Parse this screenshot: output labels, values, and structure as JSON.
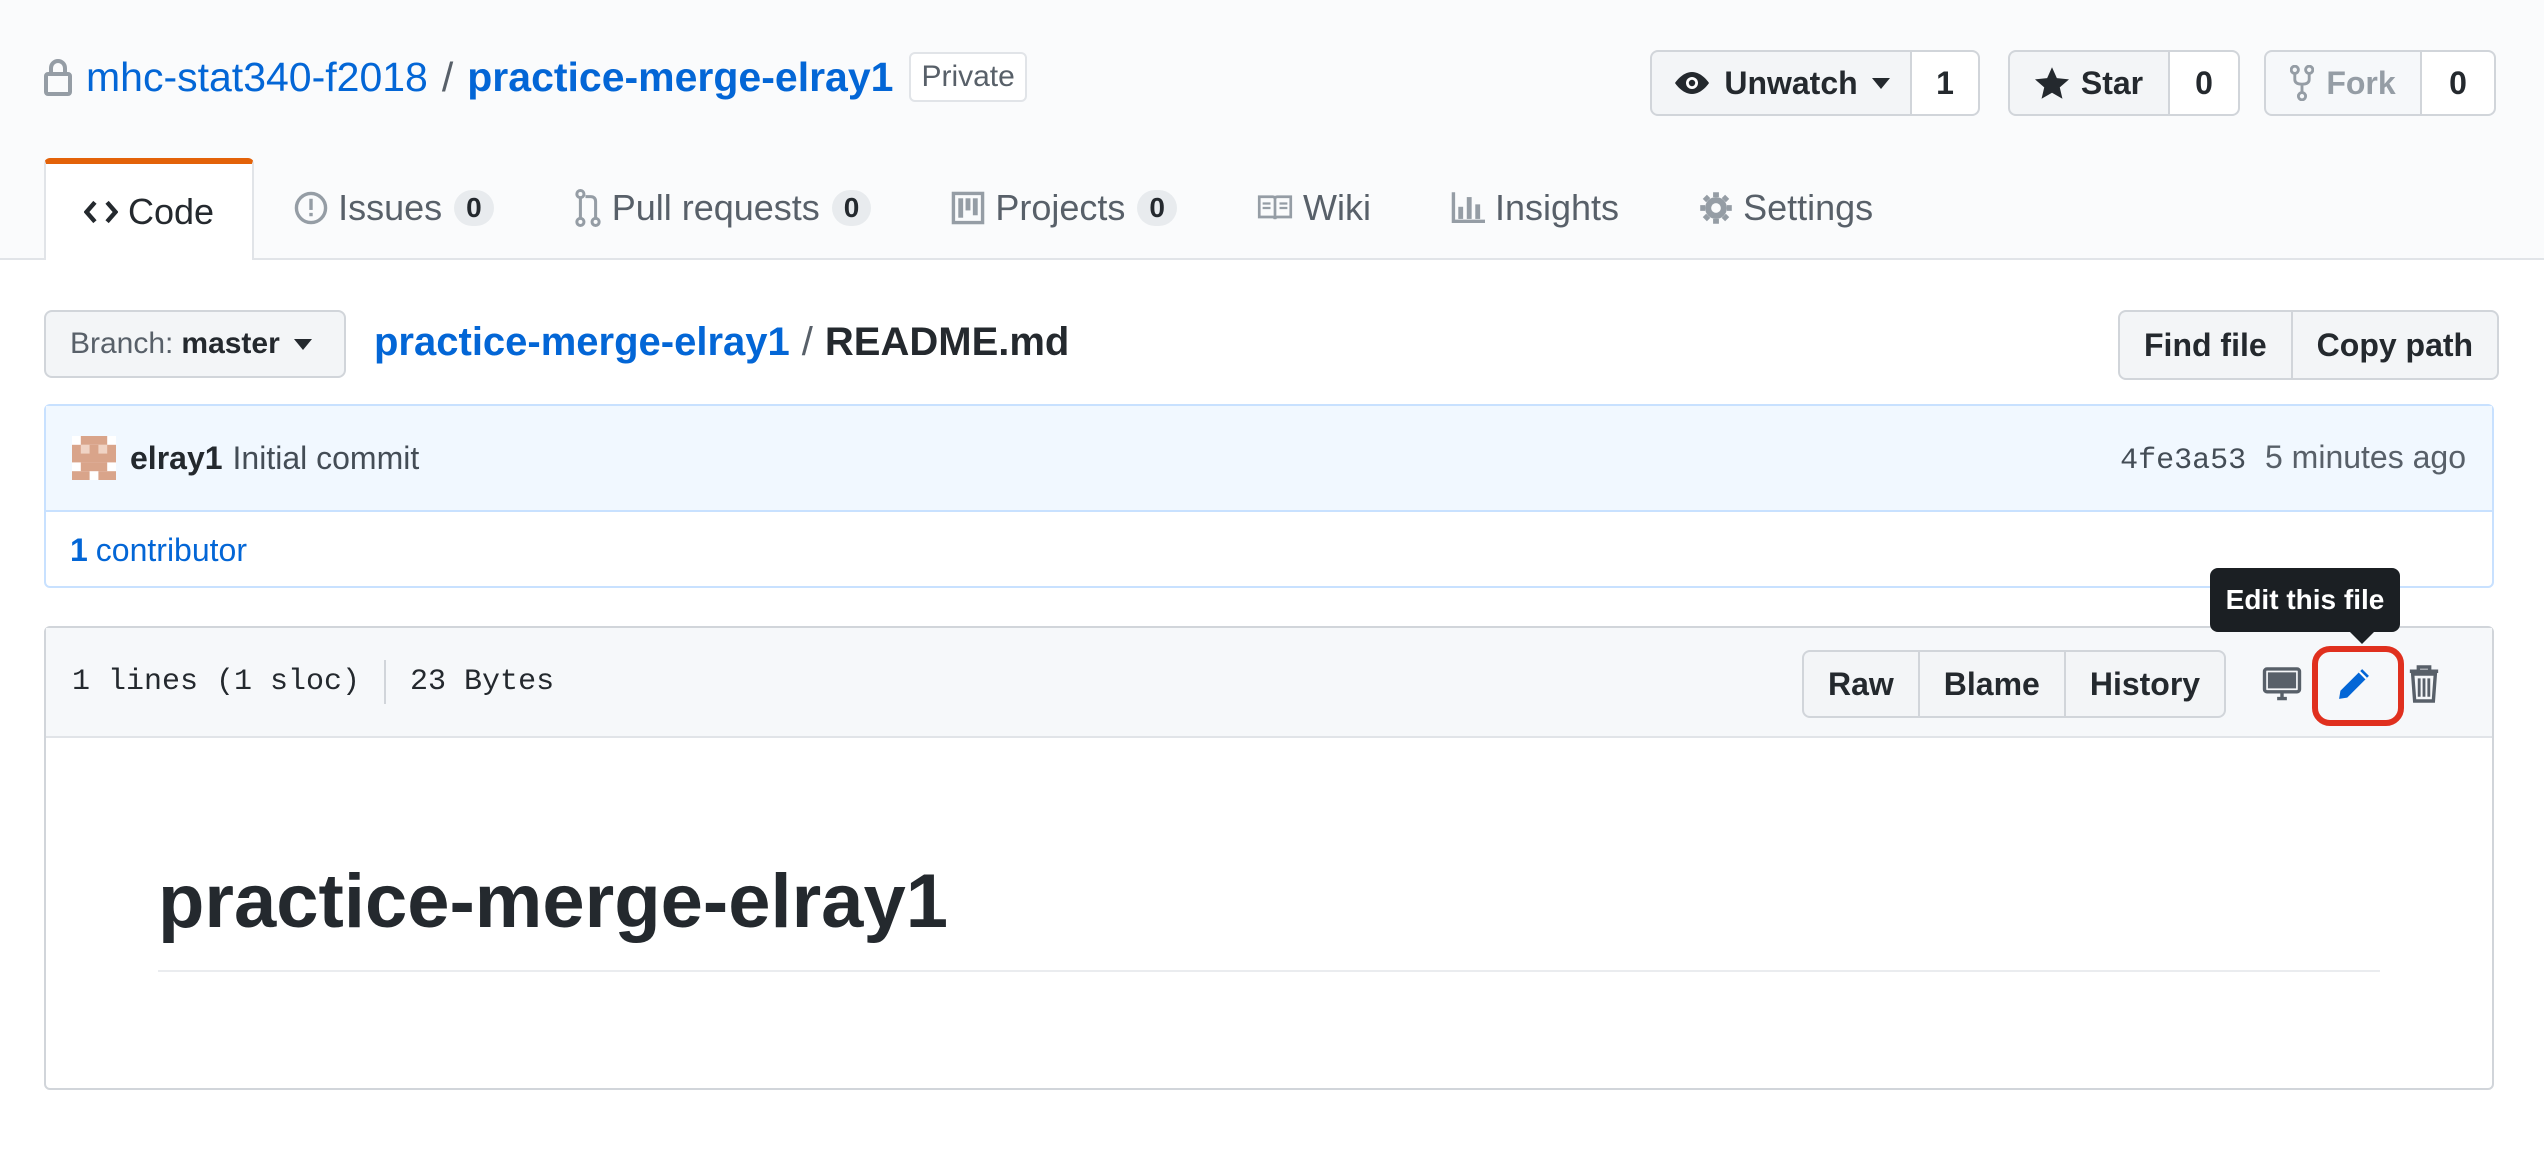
{
  "repo": {
    "owner": "mhc-stat340-f2018",
    "separator": "/",
    "name": "practice-merge-elray1",
    "visibility": "Private"
  },
  "actions": {
    "watch": {
      "label": "Unwatch",
      "count": "1"
    },
    "star": {
      "label": "Star",
      "count": "0"
    },
    "fork": {
      "label": "Fork",
      "count": "0"
    }
  },
  "tabs": [
    {
      "label": "Code",
      "icon": "code-icon"
    },
    {
      "label": "Issues",
      "count": "0",
      "icon": "issue-icon"
    },
    {
      "label": "Pull requests",
      "count": "0",
      "icon": "pull-request-icon"
    },
    {
      "label": "Projects",
      "count": "0",
      "icon": "project-icon"
    },
    {
      "label": "Wiki",
      "icon": "book-icon"
    },
    {
      "label": "Insights",
      "icon": "graph-icon"
    },
    {
      "label": "Settings",
      "icon": "gear-icon"
    }
  ],
  "branch": {
    "prefix": "Branch:",
    "name": "master"
  },
  "breadcrumb": {
    "repo": "practice-merge-elray1",
    "separator": "/",
    "file": "README.md"
  },
  "file_actions": {
    "find": "Find file",
    "copy": "Copy path"
  },
  "commit": {
    "author": "elray1",
    "message": "Initial commit",
    "sha": "4fe3a53",
    "time": "5 minutes ago"
  },
  "contributors": {
    "count": "1",
    "label": "contributor"
  },
  "file_info": {
    "lines": "1 lines (1 sloc)",
    "size": "23 Bytes"
  },
  "file_buttons": {
    "raw": "Raw",
    "blame": "Blame",
    "history": "History"
  },
  "tooltip": "Edit this file",
  "readme": {
    "heading": "practice-merge-elray1"
  },
  "colors": {
    "link": "#0366d6",
    "accent": "#e36209",
    "highlight": "#e0301e"
  }
}
